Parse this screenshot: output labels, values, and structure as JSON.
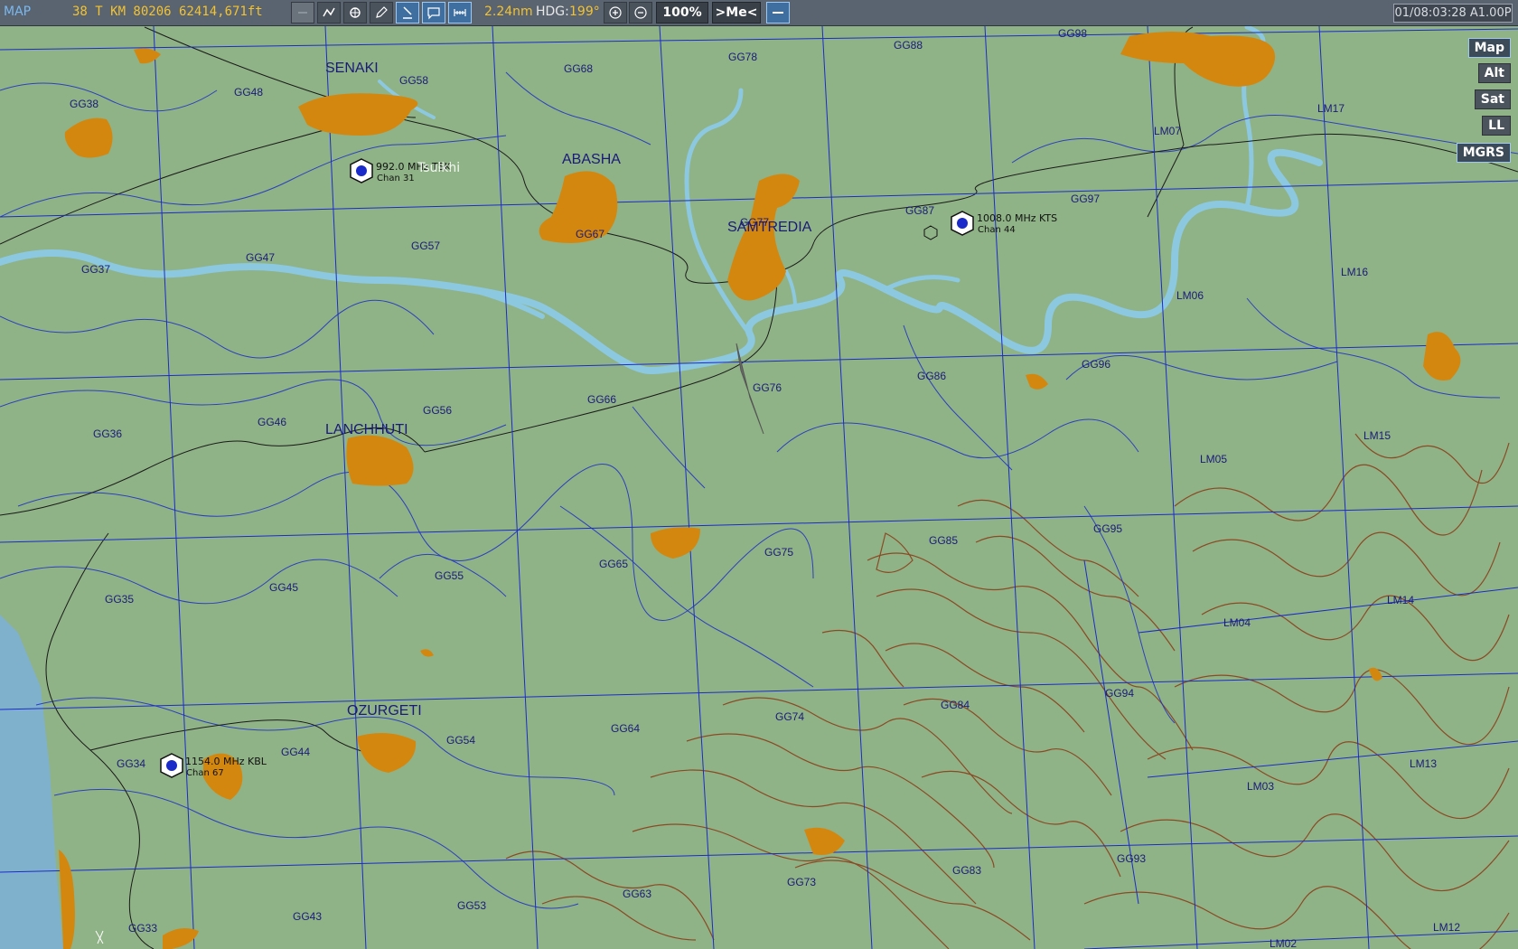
{
  "toolbar": {
    "mode": "MAP",
    "coords": "38 T KM 80206 62414,671ft",
    "distance": "2.24nm",
    "heading_label": "HDG:",
    "heading_value": "199°",
    "zoom": "100%",
    "center_me": ">Me<",
    "time": "01/08:03:28 A1.00P"
  },
  "map_layers": [
    "Map",
    "Alt",
    "Sat",
    "LL",
    "MGRS"
  ],
  "colors": {
    "land": "#8fb386",
    "urban": "#d4870f",
    "river": "#8cc8e0",
    "sea": "#7fb1cc",
    "grid": "#1b2bc9",
    "contour": "#8a4a25",
    "label": "#1a1a7a"
  },
  "cities": [
    "SENAKI",
    "ABASHA",
    "SAMTREDIA",
    "LANCHHUTI",
    "OZURGETI"
  ],
  "grid_labels": [
    "GG98",
    "GG88",
    "GG78",
    "GG68",
    "GG58",
    "GG48",
    "GG38",
    "LM17",
    "LM07",
    "GG97",
    "GG87",
    "GG77",
    "GG67",
    "GG57",
    "GG47",
    "GG37",
    "LM16",
    "LM06",
    "GG96",
    "GG86",
    "GG76",
    "GG66",
    "GG56",
    "GG46",
    "GG36",
    "LM15",
    "LM05",
    "GG95",
    "GG85",
    "GG75",
    "GG65",
    "GG55",
    "GG45",
    "GG35",
    "LM14",
    "LM04",
    "GG94",
    "GG84",
    "GG74",
    "GG64",
    "GG54",
    "GG44",
    "GG34",
    "LM13",
    "LM03",
    "GG93",
    "GG83",
    "GG73",
    "GG63",
    "GG53",
    "GG43",
    "GG33",
    "LM12",
    "LM02"
  ],
  "airfields": [
    {
      "freq": "992.0 MHz TSK",
      "chan": "Chan 31",
      "name": "Tsulkhi"
    },
    {
      "freq": "1008.0 MHz KTS",
      "chan": "Chan 44"
    },
    {
      "freq": "1154.0 MHz KBL",
      "chan": "Chan 67"
    }
  ]
}
